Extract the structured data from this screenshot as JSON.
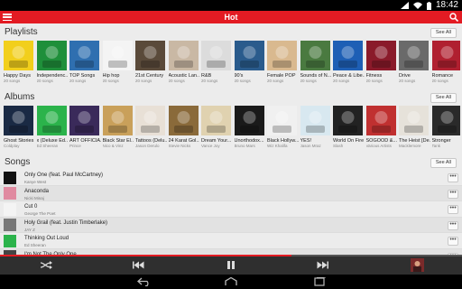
{
  "status": {
    "time": "18:42"
  },
  "appbar": {
    "title": "Hot"
  },
  "playlists": {
    "title": "Playlists",
    "see_all": "See All",
    "items": [
      {
        "title": "Happy Days",
        "sub": "20 songs",
        "cover": "smiley-face",
        "bg": "#f2cf1c"
      },
      {
        "title": "Independenc...",
        "sub": "20 songs",
        "cover": "nigeria-flag",
        "bg": "#1f8f3a"
      },
      {
        "title": "TOP Songs",
        "sub": "20 songs",
        "cover": "dove",
        "bg": "#2f6fb0"
      },
      {
        "title": "Hip hop",
        "sub": "20 songs",
        "cover": "hip-hop-art",
        "bg": "#f4f4f4"
      },
      {
        "title": "21st Century",
        "sub": "20 songs",
        "cover": "city-lights",
        "bg": "#5a4a3a"
      },
      {
        "title": "Acoustic Lan...",
        "sub": "20 songs",
        "cover": "guitar",
        "bg": "#c9b8a4"
      },
      {
        "title": "R&B",
        "sub": "20 songs",
        "cover": "hooded-figure",
        "bg": "#dcdcdc"
      },
      {
        "title": "90's",
        "sub": "20 songs",
        "cover": "1990-cover",
        "bg": "#2a5b8c"
      },
      {
        "title": "Female POP",
        "sub": "20 songs",
        "cover": "singer-photo",
        "bg": "#d9b98f"
      },
      {
        "title": "Sounds of N...",
        "sub": "20 songs",
        "cover": "nature-scene",
        "bg": "#4a7a40"
      },
      {
        "title": "Peace & Libe...",
        "sub": "20 songs",
        "cover": "dove",
        "bg": "#1e5fb5"
      },
      {
        "title": "Fitness",
        "sub": "20 songs",
        "cover": "fitness-art",
        "bg": "#8a1a2a"
      },
      {
        "title": "Drive",
        "sub": "20 songs",
        "cover": "road",
        "bg": "#6a6a6a"
      },
      {
        "title": "Romance",
        "sub": "20 songs",
        "cover": "roses",
        "bg": "#b02030"
      }
    ]
  },
  "albums": {
    "title": "Albums",
    "see_all": "See All",
    "items": [
      {
        "title": "Ghost Stories",
        "sub": "Coldplay",
        "cover": "angel-wings",
        "bg": "#1a2a44"
      },
      {
        "title": "x (Deluxe Ed...",
        "sub": "Ed Sheeran",
        "cover": "green-x",
        "bg": "#2bb34b"
      },
      {
        "title": "ART OFFICIA...",
        "sub": "Prince",
        "cover": "art-portrait",
        "bg": "#3a2a5a"
      },
      {
        "title": "Black Star El...",
        "sub": "Nico & Vinz",
        "cover": "black-star-art",
        "bg": "#c9a05a"
      },
      {
        "title": "Tattoos (Delu...",
        "sub": "Jason Derulo",
        "cover": "portrait",
        "bg": "#e8e0d6"
      },
      {
        "title": "24 Karat Gol...",
        "sub": "Stevie Nicks",
        "cover": "portrait",
        "bg": "#8a6a3a"
      },
      {
        "title": "Dream Your...",
        "sub": "Vance Joy",
        "cover": "painting",
        "bg": "#e0d2b0"
      },
      {
        "title": "Unorthodox...",
        "sub": "Bruno Mars",
        "cover": "portrait",
        "bg": "#1a1a1a"
      },
      {
        "title": "Black Hollyw...",
        "sub": "Wiz Khalifa",
        "cover": "skull-art",
        "bg": "#f0f0f0"
      },
      {
        "title": "YES!",
        "sub": "Jason Mraz",
        "cover": "yes-art",
        "bg": "#d8e8f0"
      },
      {
        "title": "World On Fire",
        "sub": "Slash",
        "cover": "slash-logo",
        "bg": "#222222"
      },
      {
        "title": "SOGOOD &...",
        "sub": "Various Artists",
        "cover": "sogood-art",
        "bg": "#c03030"
      },
      {
        "title": "The Heist [De...",
        "sub": "Macklemore",
        "cover": "the-heist",
        "bg": "#e6e2da"
      },
      {
        "title": "Stronger",
        "sub": "Tank",
        "cover": "portrait",
        "bg": "#2a2a2a"
      }
    ]
  },
  "songs": {
    "title": "Songs",
    "see_all": "See All",
    "more_label": "•••",
    "items": [
      {
        "title": "Only One (feat. Paul McCartney)",
        "artist": "Kanye West",
        "thumb_bg": "#111111"
      },
      {
        "title": "Anaconda",
        "artist": "Nicki Minaj",
        "thumb_bg": "#e08aa0"
      },
      {
        "title": "Cut 0",
        "artist": "George The Poet",
        "thumb_bg": "#f4f4f4"
      },
      {
        "title": "Holy Grail (feat. Justin Timberlake)",
        "artist": "JAY Z",
        "thumb_bg": "#777777"
      },
      {
        "title": "Thinking Out Loud",
        "artist": "Ed Sheeran",
        "thumb_bg": "#2bb34b"
      },
      {
        "title": "I'm Not The Only One",
        "artist": "",
        "thumb_bg": "#444444"
      }
    ]
  },
  "player": {
    "progress": 0.63
  },
  "colors": {
    "accent": "#e31b23"
  }
}
